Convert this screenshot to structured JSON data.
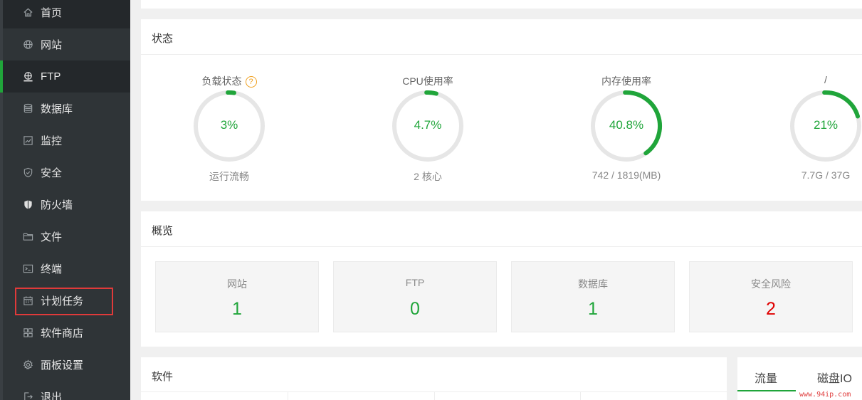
{
  "sidebar": {
    "items": [
      {
        "label": "首页",
        "icon": "home-icon"
      },
      {
        "label": "网站",
        "icon": "globe-icon"
      },
      {
        "label": "FTP",
        "icon": "ftp-icon"
      },
      {
        "label": "数据库",
        "icon": "database-icon"
      },
      {
        "label": "监控",
        "icon": "monitor-icon"
      },
      {
        "label": "安全",
        "icon": "shield-icon"
      },
      {
        "label": "防火墙",
        "icon": "firewall-icon"
      },
      {
        "label": "文件",
        "icon": "folder-icon"
      },
      {
        "label": "终端",
        "icon": "terminal-icon"
      },
      {
        "label": "计划任务",
        "icon": "calendar-icon"
      },
      {
        "label": "软件商店",
        "icon": "apps-icon"
      },
      {
        "label": "面板设置",
        "icon": "gear-icon"
      },
      {
        "label": "退出",
        "icon": "logout-icon"
      }
    ],
    "active_item": "FTP",
    "highlighted_item": "计划任务"
  },
  "status": {
    "title": "状态",
    "gauges": [
      {
        "label": "负载状态",
        "value": "3%",
        "percent": 3,
        "sub": "运行流畅",
        "help_icon": "?"
      },
      {
        "label": "CPU使用率",
        "value": "4.7%",
        "percent": 4.7,
        "sub": "2 核心"
      },
      {
        "label": "内存使用率",
        "value": "40.8%",
        "percent": 40.8,
        "sub": "742 / 1819(MB)"
      },
      {
        "label": "/",
        "value": "21%",
        "percent": 21,
        "sub": "7.7G / 37G"
      }
    ]
  },
  "overview": {
    "title": "概览",
    "cards": [
      {
        "label": "网站",
        "value": "1"
      },
      {
        "label": "FTP",
        "value": "0"
      },
      {
        "label": "数据库",
        "value": "1"
      },
      {
        "label": "安全风险",
        "value": "2"
      }
    ]
  },
  "software": {
    "title": "软件"
  },
  "traffic": {
    "tabs": [
      "流量",
      "磁盘IO"
    ],
    "active_tab": "流量"
  },
  "watermark": "www.94ip.com",
  "colors": {
    "accent": "#20a53a",
    "danger": "#e00000",
    "sidebar_bg": "#2f3437",
    "highlight": "#e03a3a"
  }
}
